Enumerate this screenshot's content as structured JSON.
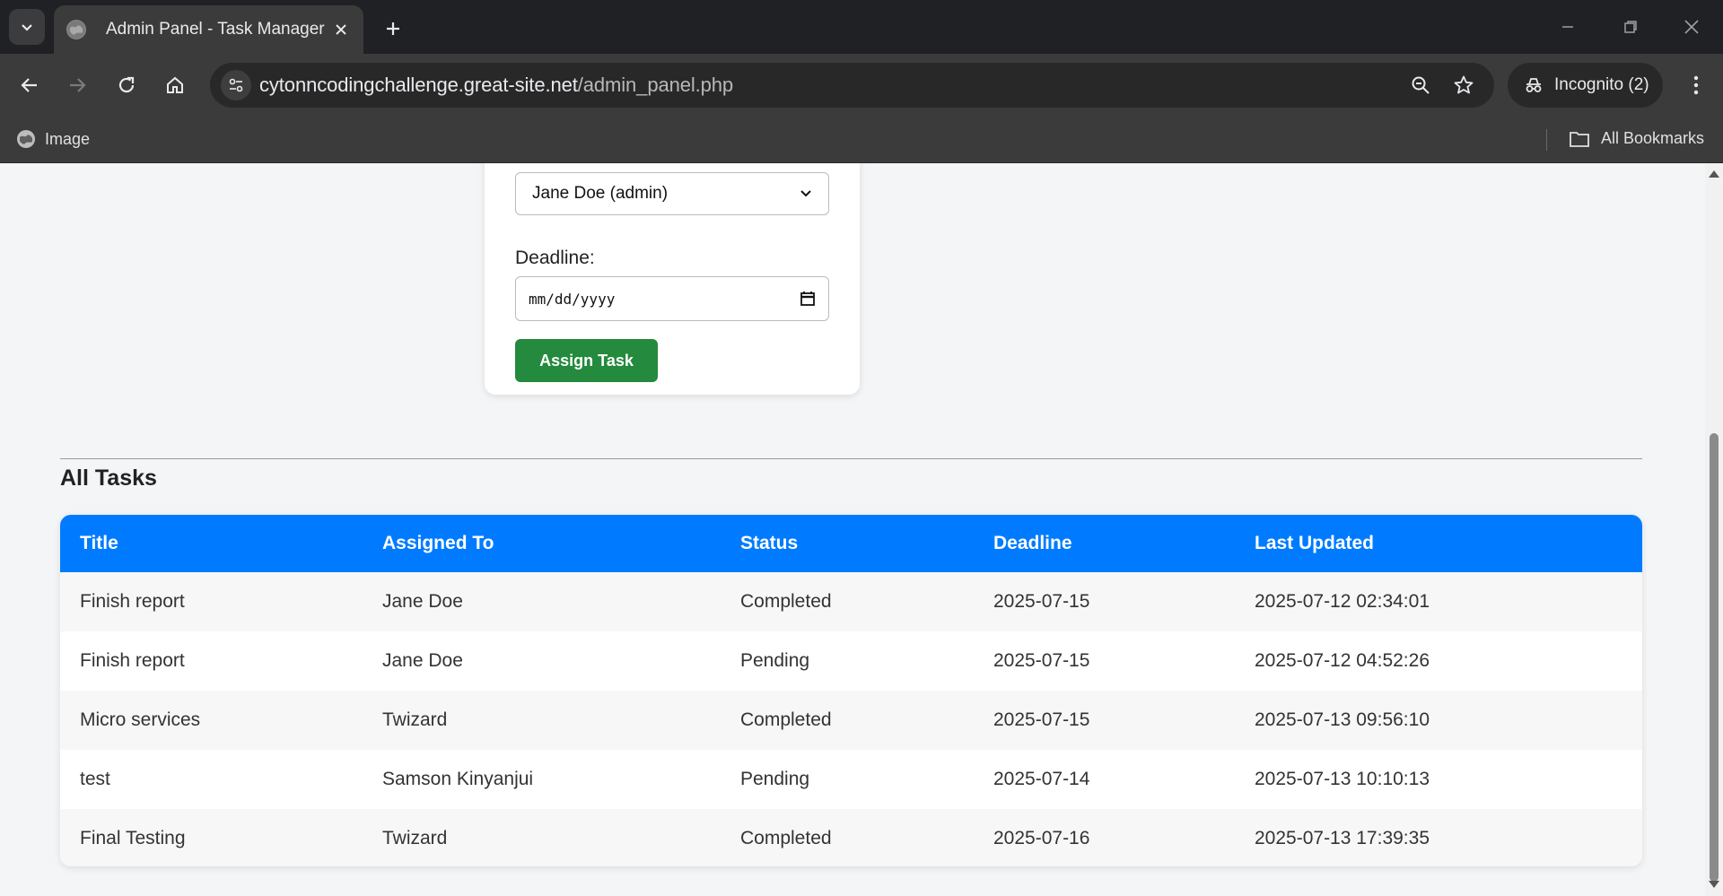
{
  "browser": {
    "tab_title": "Admin Panel - Task Manager",
    "url_domain": "cytonncodingchallenge.great-site.net",
    "url_path": "/admin_panel.php",
    "incognito_label": "Incognito (2)",
    "bookmark_item": "Image",
    "all_bookmarks": "All Bookmarks"
  },
  "form": {
    "assign_select_value": "Jane Doe (admin)",
    "deadline_label": "Deadline:",
    "deadline_placeholder": "mm/dd/yyyy",
    "assign_button": "Assign Task"
  },
  "tasks": {
    "section_title": "All Tasks",
    "columns": [
      "Title",
      "Assigned To",
      "Status",
      "Deadline",
      "Last Updated"
    ],
    "rows": [
      [
        "Finish report",
        "Jane Doe",
        "Completed",
        "2025-07-15",
        "2025-07-12 02:34:01"
      ],
      [
        "Finish report",
        "Jane Doe",
        "Pending",
        "2025-07-15",
        "2025-07-12 04:52:26"
      ],
      [
        "Micro services",
        "Twizard",
        "Completed",
        "2025-07-15",
        "2025-07-13 09:56:10"
      ],
      [
        "test",
        "Samson Kinyanjui",
        "Pending",
        "2025-07-14",
        "2025-07-13 10:10:13"
      ],
      [
        "Final Testing",
        "Twizard",
        "Completed",
        "2025-07-16",
        "2025-07-13 17:39:35"
      ]
    ]
  },
  "colors": {
    "header_blue": "#007bff",
    "button_green": "#248a3d"
  },
  "icons": [
    "tab-search-icon",
    "globe-icon",
    "close-icon",
    "plus-icon",
    "minimize-icon",
    "restore-icon",
    "window-close-icon",
    "back-icon",
    "forward-icon",
    "reload-icon",
    "home-icon",
    "site-info-icon",
    "zoom-icon",
    "star-icon",
    "incognito-icon",
    "kebab-menu-icon",
    "folder-icon",
    "chevron-down-icon",
    "calendar-icon"
  ]
}
